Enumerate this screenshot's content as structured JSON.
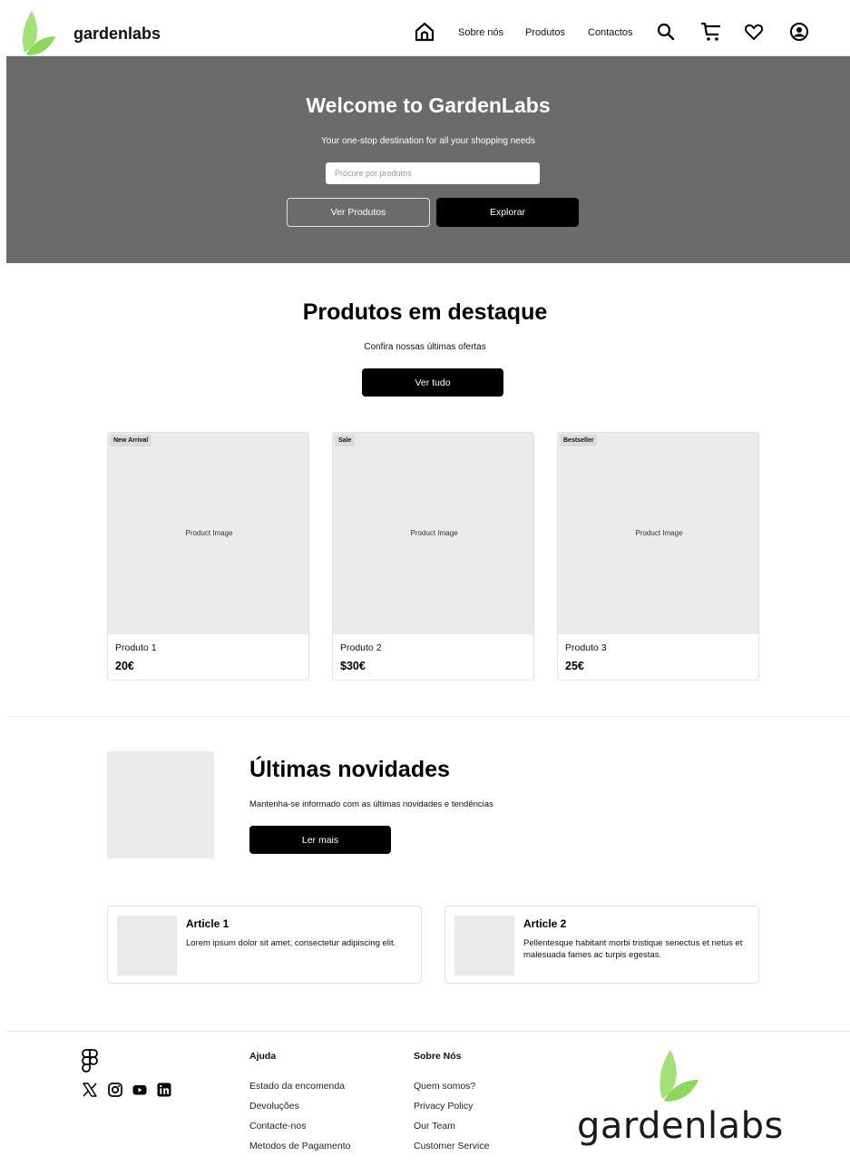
{
  "colors": {
    "hero_bg": "#6b6b6b",
    "leaf_green": "#a4e07a",
    "card_bg": "#ebebeb",
    "button_dark": "#000000"
  },
  "header": {
    "brand": "gardenlabs",
    "nav": [
      "Sobre nós",
      "Produtos",
      "Contactos"
    ],
    "icons": [
      "home-icon",
      "search-icon",
      "cart-icon",
      "heart-icon",
      "user-icon"
    ]
  },
  "hero": {
    "title": "Welcome to GardenLabs",
    "subtitle": "Your one-stop destination for all your shopping needs",
    "search_placeholder": "Procure por produtos",
    "btn_products": "Ver Produtos",
    "btn_explore": "Explorar"
  },
  "featured": {
    "title": "Produtos em destaque",
    "subtitle": "Confira nossas últimas ofertas",
    "btn_all": "Ver tudo",
    "products": [
      {
        "badge": "New Arrival",
        "image_label": "Product Image",
        "name": "Produto 1",
        "price": "20€"
      },
      {
        "badge": "Sale",
        "image_label": "Product Image",
        "name": "Produto 2",
        "price": "$30€"
      },
      {
        "badge": "Bestseller",
        "image_label": "Product Image",
        "name": "Produto 3",
        "price": "25€"
      }
    ]
  },
  "news": {
    "title": "Últimas novidades",
    "subtitle": "Mantenha-se informado com as últimas novidades e tendências",
    "btn_more": "Ler mais",
    "articles": [
      {
        "title": "Article 1",
        "body": "Lorem ipsum dolor sit amet, consectetur adipiscing elit."
      },
      {
        "title": "Article 2",
        "body": "Pellentesque habitant morbi tristique senectus et netus et malesuada fames ac turpis egestas."
      }
    ]
  },
  "footer": {
    "social": [
      "x-icon",
      "instagram-icon",
      "youtube-icon",
      "linkedin-icon"
    ],
    "col1": {
      "title": "Ajuda",
      "links": [
        "Estado da encomenda",
        "Devoluções",
        "Contacte-nos",
        "Metodos de Pagamento"
      ]
    },
    "col2": {
      "title": "Sobre Nós",
      "links": [
        "Quem somos?",
        "Privacy Policy",
        "Our Team",
        "Customer Service"
      ]
    },
    "brand": "gardenlabs"
  }
}
